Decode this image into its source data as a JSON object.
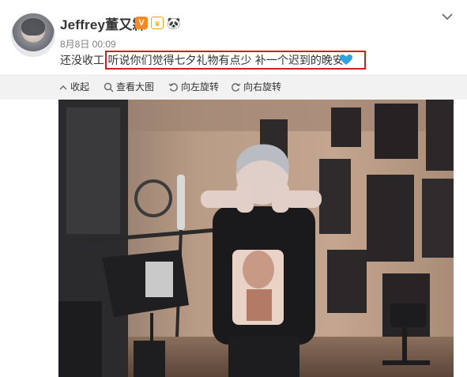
{
  "post": {
    "username": "Jeffrey董又霖",
    "badge_verified": "V",
    "badge_vip": "♛",
    "badge_panda": "🐼",
    "date": "8月8日 00:09",
    "text_prefix": "还没收工",
    "text_highlight": "听说你们觉得七夕礼物有点少 补一个迟到的晚安",
    "emoji": "blue-heart-icon"
  },
  "toolbar": {
    "collapse": "收起",
    "view_large": "查看大图",
    "rotate_left": "向左旋转",
    "rotate_right": "向右旋转"
  },
  "colors": {
    "highlight_border": "#c8241e",
    "heart": "#2fa3e0",
    "toolbar_bg": "#f2f2f2"
  }
}
